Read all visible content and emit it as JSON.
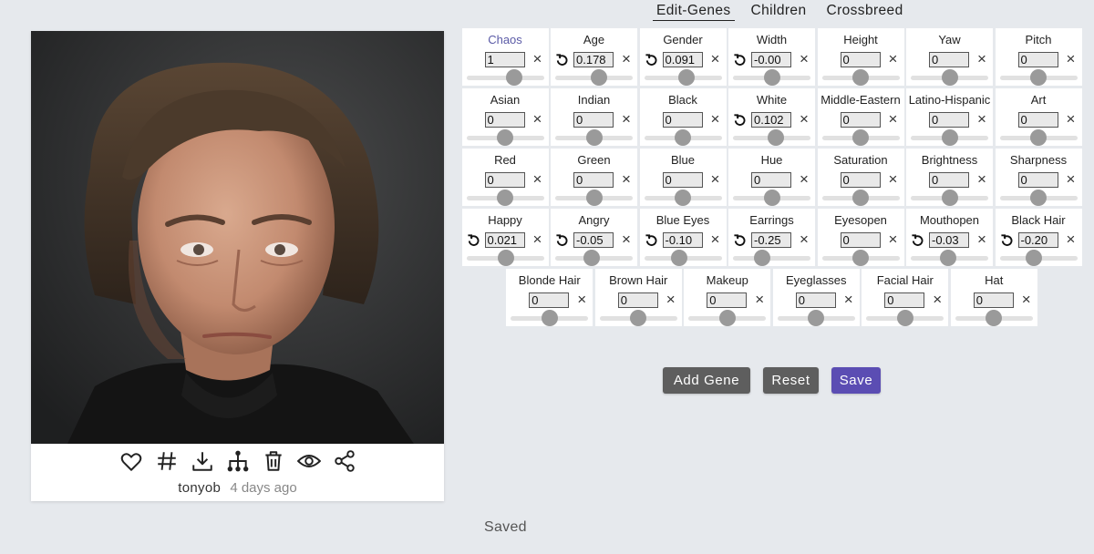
{
  "portrait": {
    "alt": "portrait"
  },
  "actions": [
    {
      "icon": "heart-icon",
      "name": "like-button"
    },
    {
      "icon": "hash-icon",
      "name": "tag-button"
    },
    {
      "icon": "download-icon",
      "name": "download-button"
    },
    {
      "icon": "family-tree-icon",
      "name": "lineage-button"
    },
    {
      "icon": "trash-icon",
      "name": "delete-button"
    },
    {
      "icon": "eye-icon",
      "name": "view-button"
    },
    {
      "icon": "share-icon",
      "name": "share-button"
    }
  ],
  "meta": {
    "user": "tonyob",
    "time": "4 days ago"
  },
  "tabs": [
    "Edit-Genes",
    "Children",
    "Crossbreed"
  ],
  "active_tab": "Edit-Genes",
  "genes": [
    [
      {
        "label": "Chaos",
        "value": "1",
        "reset": false,
        "slider": 0.62
      },
      {
        "label": "Age",
        "value": "0.178",
        "reset": true,
        "slider": 0.57
      },
      {
        "label": "Gender",
        "value": "0.091",
        "reset": true,
        "slider": 0.55
      },
      {
        "label": "Width",
        "value": "-0.00",
        "reset": true,
        "slider": 0.5
      },
      {
        "label": "Height",
        "value": "0",
        "reset": false,
        "slider": 0.5
      },
      {
        "label": "Yaw",
        "value": "0",
        "reset": false,
        "slider": 0.5
      },
      {
        "label": "Pitch",
        "value": "0",
        "reset": false,
        "slider": 0.5
      }
    ],
    [
      {
        "label": "Asian",
        "value": "0",
        "reset": false,
        "slider": 0.5
      },
      {
        "label": "Indian",
        "value": "0",
        "reset": false,
        "slider": 0.5
      },
      {
        "label": "Black",
        "value": "0",
        "reset": false,
        "slider": 0.5
      },
      {
        "label": "White",
        "value": "0.102",
        "reset": true,
        "slider": 0.55
      },
      {
        "label": "Middle-Eastern",
        "value": "0",
        "reset": false,
        "slider": 0.5
      },
      {
        "label": "Latino-Hispanic",
        "value": "0",
        "reset": false,
        "slider": 0.5
      },
      {
        "label": "Art",
        "value": "0",
        "reset": false,
        "slider": 0.5
      }
    ],
    [
      {
        "label": "Red",
        "value": "0",
        "reset": false,
        "slider": 0.5
      },
      {
        "label": "Green",
        "value": "0",
        "reset": false,
        "slider": 0.5
      },
      {
        "label": "Blue",
        "value": "0",
        "reset": false,
        "slider": 0.5
      },
      {
        "label": "Hue",
        "value": "0",
        "reset": false,
        "slider": 0.5
      },
      {
        "label": "Saturation",
        "value": "0",
        "reset": false,
        "slider": 0.5
      },
      {
        "label": "Brightness",
        "value": "0",
        "reset": false,
        "slider": 0.5
      },
      {
        "label": "Sharpness",
        "value": "0",
        "reset": false,
        "slider": 0.5
      }
    ],
    [
      {
        "label": "Happy",
        "value": "0.021",
        "reset": true,
        "slider": 0.51
      },
      {
        "label": "Angry",
        "value": "-0.05",
        "reset": true,
        "slider": 0.47
      },
      {
        "label": "Blue Eyes",
        "value": "-0.10",
        "reset": true,
        "slider": 0.45
      },
      {
        "label": "Earrings",
        "value": "-0.25",
        "reset": true,
        "slider": 0.38
      },
      {
        "label": "Eyesopen",
        "value": "0",
        "reset": false,
        "slider": 0.5
      },
      {
        "label": "Mouthopen",
        "value": "-0.03",
        "reset": true,
        "slider": 0.48
      },
      {
        "label": "Black Hair",
        "value": "-0.20",
        "reset": true,
        "slider": 0.44
      }
    ],
    [
      {
        "label": "Blonde Hair",
        "value": "0",
        "reset": false,
        "slider": 0.5
      },
      {
        "label": "Brown Hair",
        "value": "0",
        "reset": false,
        "slider": 0.5
      },
      {
        "label": "Makeup",
        "value": "0",
        "reset": false,
        "slider": 0.5
      },
      {
        "label": "Eyeglasses",
        "value": "0",
        "reset": false,
        "slider": 0.5
      },
      {
        "label": "Facial Hair",
        "value": "0",
        "reset": false,
        "slider": 0.5
      },
      {
        "label": "Hat",
        "value": "0",
        "reset": false,
        "slider": 0.5
      }
    ]
  ],
  "buttons": {
    "add_gene": "Add Gene",
    "reset": "Reset",
    "save": "Save"
  },
  "colors": {
    "accent": "#5b4db3",
    "button_gray": "#5e5e5e",
    "chaos_label": "#5a5aa6"
  },
  "status": "Saved"
}
